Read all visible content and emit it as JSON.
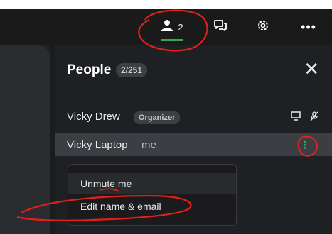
{
  "toolbar": {
    "people_count": "2",
    "icons": [
      "person-icon",
      "chat-icon",
      "gear-icon",
      "more-icon"
    ],
    "accent_color": "#34a853",
    "more_label": "•••"
  },
  "panel": {
    "title": "People",
    "badge": "2/251",
    "close_label": "✕"
  },
  "participants": [
    {
      "name": "Vicky Drew",
      "tag": "Organizer"
    },
    {
      "name": "Vicky Laptop",
      "tag": "me"
    }
  ],
  "context_menu": {
    "items": [
      "Unmute me",
      "Edit name & email"
    ]
  },
  "annotations": {
    "color": "#e0201b"
  }
}
